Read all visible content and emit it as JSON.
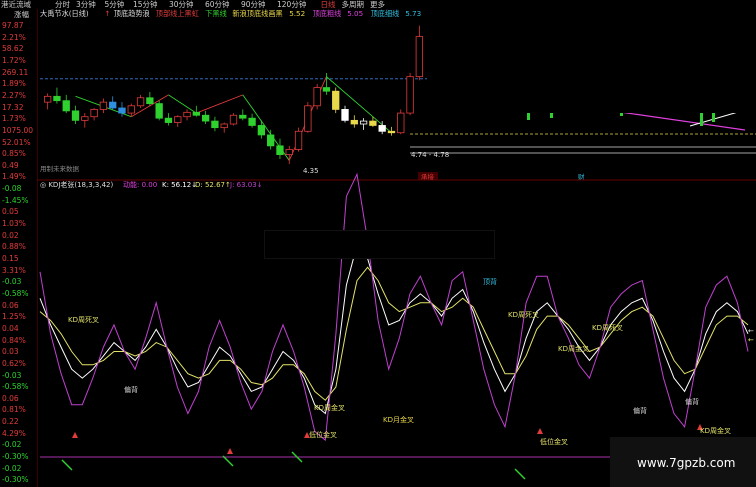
{
  "topbar": {
    "app": "港近流域",
    "periods": [
      "分时",
      "3分钟",
      "5分钟",
      "15分钟",
      "30分钟",
      "60分钟",
      "90分钟",
      "120分钟",
      "日线",
      "多周期",
      "更多"
    ]
  },
  "header": {
    "label": "涨幅",
    "title": "大禹节水(日线)",
    "arrow": "↑",
    "i1": "顶底趋势浪",
    "i2": "顶部线上黑虹",
    "i3": "下黑线",
    "i4": "新浪顶底线画黑",
    "i4v": "5.52",
    "i5": "顶底粗线",
    "i5v": "5.05",
    "i6": "顶底细线",
    "i6v": "5.73"
  },
  "price_labels": {
    "range": "4.74 - 4.78",
    "low": "4.35",
    "tag1": "承接",
    "tag2": "财"
  },
  "bottom_note": "用制未来数据",
  "kd_header": {
    "name": "KDJ老张(18,3,3,42)",
    "dyn_label": "动能:",
    "dyn": "0.00",
    "k_label": "K:",
    "k": "56.12",
    "k_arrow": "↓",
    "d_label": "D:",
    "d": "52.67",
    "d_arrow": "↑",
    "j_label": "J:",
    "j": "63.03",
    "j_arrow": "↓"
  },
  "left_axis": [
    {
      "t": "97.87",
      "c": "#e23b3b"
    },
    {
      "t": "2.21%",
      "c": "#e23b3b"
    },
    {
      "t": "58.62",
      "c": "#e23b3b"
    },
    {
      "t": "1.72%",
      "c": "#e23b3b"
    },
    {
      "t": "269.11",
      "c": "#e23b3b"
    },
    {
      "t": "1.89%",
      "c": "#e23b3b"
    },
    {
      "t": "2.27%",
      "c": "#e23b3b"
    },
    {
      "t": "17.32",
      "c": "#e23b3b"
    },
    {
      "t": "1.73%",
      "c": "#e23b3b"
    },
    {
      "t": "1075.00",
      "c": "#e23b3b"
    },
    {
      "t": "52.01%",
      "c": "#e23b3b"
    },
    {
      "t": "0.85%",
      "c": "#e23b3b"
    },
    {
      "t": "0.49",
      "c": "#e23b3b"
    },
    {
      "t": "1.49%",
      "c": "#e23b3b"
    },
    {
      "t": "-0.08",
      "c": "#2fd12f"
    },
    {
      "t": "-1.45%",
      "c": "#2fd12f"
    },
    {
      "t": "0.05",
      "c": "#e23b3b"
    },
    {
      "t": "1.03%",
      "c": "#e23b3b"
    },
    {
      "t": "0.02",
      "c": "#e23b3b"
    },
    {
      "t": "0.88%",
      "c": "#e23b3b"
    },
    {
      "t": "0.15",
      "c": "#e23b3b"
    },
    {
      "t": "3.31%",
      "c": "#e23b3b"
    },
    {
      "t": "-0.03",
      "c": "#2fd12f"
    },
    {
      "t": "-0.58%",
      "c": "#2fd12f"
    },
    {
      "t": "0.06",
      "c": "#e23b3b"
    },
    {
      "t": "1.25%",
      "c": "#e23b3b"
    },
    {
      "t": "0.04",
      "c": "#e23b3b"
    },
    {
      "t": "0.84%",
      "c": "#e23b3b"
    },
    {
      "t": "0.03",
      "c": "#e23b3b"
    },
    {
      "t": "0.62%",
      "c": "#e23b3b"
    },
    {
      "t": "-0.03",
      "c": "#2fd12f"
    },
    {
      "t": "-0.58%",
      "c": "#2fd12f"
    },
    {
      "t": "0.06",
      "c": "#e23b3b"
    },
    {
      "t": "0.81%",
      "c": "#e23b3b"
    },
    {
      "t": "0.22",
      "c": "#e23b3b"
    },
    {
      "t": "4.29%",
      "c": "#e23b3b"
    },
    {
      "t": "-0.02",
      "c": "#2fd12f"
    },
    {
      "t": "-0.30%",
      "c": "#2fd12f"
    },
    {
      "t": "-0.02",
      "c": "#2fd12f"
    },
    {
      "t": "-0.30%",
      "c": "#2fd12f"
    }
  ],
  "chart_data": [
    {
      "type": "candlestick",
      "title": "大禹节水(日线)",
      "ylim": [
        4.2,
        6.3
      ],
      "lines": [
        {
          "name": "顶底粗线",
          "value": 5.05,
          "color": "#e8d84a"
        },
        {
          "name": "新浪顶底线画黑",
          "value": 5.52,
          "color": "#3a7bd5"
        },
        {
          "name": "顶底细线",
          "value": 5.73,
          "color": "#dddddd"
        }
      ],
      "candles": [
        [
          5.2,
          5.32,
          5.1,
          5.28
        ],
        [
          5.28,
          5.4,
          5.18,
          5.22
        ],
        [
          5.22,
          5.3,
          5.05,
          5.08
        ],
        [
          5.08,
          5.15,
          4.9,
          4.95
        ],
        [
          4.95,
          5.05,
          4.85,
          5.0
        ],
        [
          5.0,
          5.12,
          4.95,
          5.1
        ],
        [
          5.1,
          5.25,
          5.05,
          5.2
        ],
        [
          5.2,
          5.28,
          5.1,
          5.12
        ],
        [
          5.12,
          5.2,
          5.0,
          5.05
        ],
        [
          5.05,
          5.18,
          5.0,
          5.15
        ],
        [
          5.15,
          5.3,
          5.12,
          5.26
        ],
        [
          5.26,
          5.34,
          5.15,
          5.18
        ],
        [
          5.18,
          5.22,
          4.95,
          4.98
        ],
        [
          4.98,
          5.05,
          4.88,
          4.92
        ],
        [
          4.92,
          5.02,
          4.86,
          5.0
        ],
        [
          5.0,
          5.1,
          4.95,
          5.06
        ],
        [
          5.06,
          5.15,
          5.0,
          5.02
        ],
        [
          5.02,
          5.08,
          4.9,
          4.94
        ],
        [
          4.94,
          5.0,
          4.8,
          4.85
        ],
        [
          4.85,
          4.92,
          4.78,
          4.9
        ],
        [
          4.9,
          5.05,
          4.88,
          5.02
        ],
        [
          5.02,
          5.1,
          4.95,
          4.98
        ],
        [
          4.98,
          5.04,
          4.85,
          4.88
        ],
        [
          4.88,
          4.95,
          4.7,
          4.75
        ],
        [
          4.75,
          4.82,
          4.55,
          4.6
        ],
        [
          4.6,
          4.7,
          4.42,
          4.48
        ],
        [
          4.48,
          4.6,
          4.35,
          4.55
        ],
        [
          4.55,
          4.85,
          4.52,
          4.8
        ],
        [
          4.8,
          5.2,
          4.78,
          5.15
        ],
        [
          5.15,
          5.45,
          5.1,
          5.4
        ],
        [
          5.4,
          5.6,
          5.3,
          5.35
        ],
        [
          5.35,
          5.4,
          5.05,
          5.1
        ],
        [
          5.1,
          5.15,
          4.92,
          4.95
        ],
        [
          4.95,
          5.02,
          4.85,
          4.9
        ],
        [
          4.9,
          4.98,
          4.82,
          4.94
        ],
        [
          4.94,
          5.0,
          4.86,
          4.88
        ],
        [
          4.88,
          4.94,
          4.76,
          4.8
        ],
        [
          4.8,
          4.86,
          4.74,
          4.78
        ],
        [
          4.78,
          5.1,
          4.76,
          5.05
        ],
        [
          5.05,
          5.6,
          5.02,
          5.55
        ],
        [
          5.55,
          6.25,
          5.5,
          6.1
        ]
      ]
    },
    {
      "type": "line",
      "title": "KDJ老张(18,3,3,42)",
      "ylim": [
        -10,
        120
      ],
      "series": [
        {
          "name": "K",
          "color": "#ffffff",
          "values": [
            72,
            60,
            50,
            40,
            36,
            40,
            46,
            52,
            48,
            44,
            50,
            58,
            50,
            40,
            32,
            34,
            42,
            50,
            46,
            38,
            30,
            32,
            40,
            48,
            44,
            36,
            24,
            20,
            40,
            78,
            96,
            90,
            74,
            60,
            62,
            70,
            74,
            70,
            64,
            72,
            76,
            66,
            52,
            40,
            30,
            38,
            54,
            66,
            70,
            64,
            58,
            50,
            44,
            50,
            60,
            66,
            70,
            72,
            62,
            48,
            36,
            30,
            40,
            56,
            66,
            70,
            66,
            56
          ]
        },
        {
          "name": "D",
          "color": "#e3e36a",
          "values": [
            66,
            62,
            56,
            48,
            42,
            42,
            44,
            48,
            48,
            46,
            48,
            52,
            50,
            44,
            38,
            36,
            38,
            44,
            44,
            40,
            34,
            33,
            36,
            42,
            42,
            38,
            30,
            26,
            32,
            58,
            80,
            86,
            80,
            70,
            66,
            68,
            70,
            70,
            66,
            68,
            72,
            68,
            58,
            48,
            38,
            38,
            46,
            58,
            64,
            64,
            60,
            54,
            48,
            50,
            56,
            62,
            66,
            68,
            64,
            54,
            44,
            38,
            40,
            50,
            60,
            64,
            64,
            60
          ]
        },
        {
          "name": "J",
          "color": "#c040d0",
          "values": [
            84,
            56,
            38,
            24,
            24,
            36,
            50,
            60,
            48,
            40,
            54,
            70,
            50,
            32,
            20,
            30,
            50,
            62,
            50,
            34,
            22,
            30,
            48,
            60,
            48,
            32,
            12,
            8,
            56,
            118,
            128,
            98,
            62,
            40,
            54,
            74,
            82,
            70,
            60,
            80,
            84,
            62,
            40,
            24,
            14,
            38,
            70,
            82,
            82,
            64,
            54,
            42,
            36,
            50,
            68,
            74,
            78,
            80,
            58,
            36,
            20,
            14,
            40,
            68,
            78,
            82,
            70,
            48
          ]
        }
      ]
    }
  ],
  "annotations": [
    "KD周死叉",
    "偏背",
    "KD周金叉",
    "低位金叉",
    "KD月金叉",
    "顶背",
    "KD周死叉",
    "KD周金叉",
    "低位金叉",
    "KD周死叉",
    "偏背",
    "偏背",
    "KD周金叉"
  ],
  "watermark": "www.7gpzb.com"
}
